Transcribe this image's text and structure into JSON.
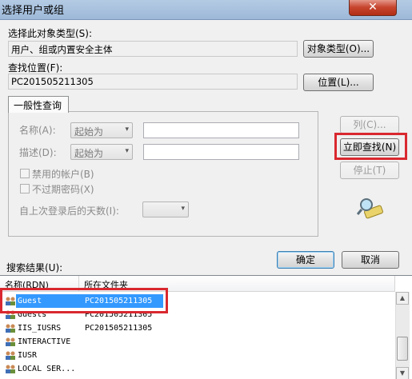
{
  "window": {
    "title": "选择用户或组",
    "close_glyph": "✕"
  },
  "object_type": {
    "label": "选择此对象类型(S):",
    "value": "用户、组或内置安全主体",
    "button": "对象类型(O)..."
  },
  "location": {
    "label": "查找位置(F):",
    "value": "PC201505211305",
    "button": "位置(L)..."
  },
  "query": {
    "tab": "一般性查询",
    "name_label": "名称(A):",
    "name_mode": "起始为",
    "desc_label": "描述(D):",
    "desc_mode": "起始为",
    "disabled_accounts": "禁用的帐户(B)",
    "non_expiring_pw": "不过期密码(X)",
    "days_since_login": "自上次登录后的天数(I):",
    "dropdown_glyph": "▾"
  },
  "side_buttons": {
    "columns": "列(C)...",
    "find_now": "立即查找(N)",
    "stop": "停止(T)"
  },
  "actions": {
    "ok": "确定",
    "cancel": "取消"
  },
  "results": {
    "label": "搜索结果(U):",
    "headers": {
      "name": "名称(RDN)",
      "folder": "所在文件夹"
    },
    "rows": [
      {
        "name": "Guest",
        "folder": "PC201505211305"
      },
      {
        "name": "Guests",
        "folder": "PC201505211305"
      },
      {
        "name": "IIS_IUSRS",
        "folder": "PC201505211305"
      },
      {
        "name": "INTERACTIVE",
        "folder": ""
      },
      {
        "name": "IUSR",
        "folder": ""
      },
      {
        "name": "LOCAL SER...",
        "folder": ""
      }
    ],
    "selected_index": 0,
    "scroll_up": "▲",
    "scroll_down": "▼"
  },
  "colors": {
    "highlight": "#d9282f",
    "selection": "#3399ff"
  }
}
